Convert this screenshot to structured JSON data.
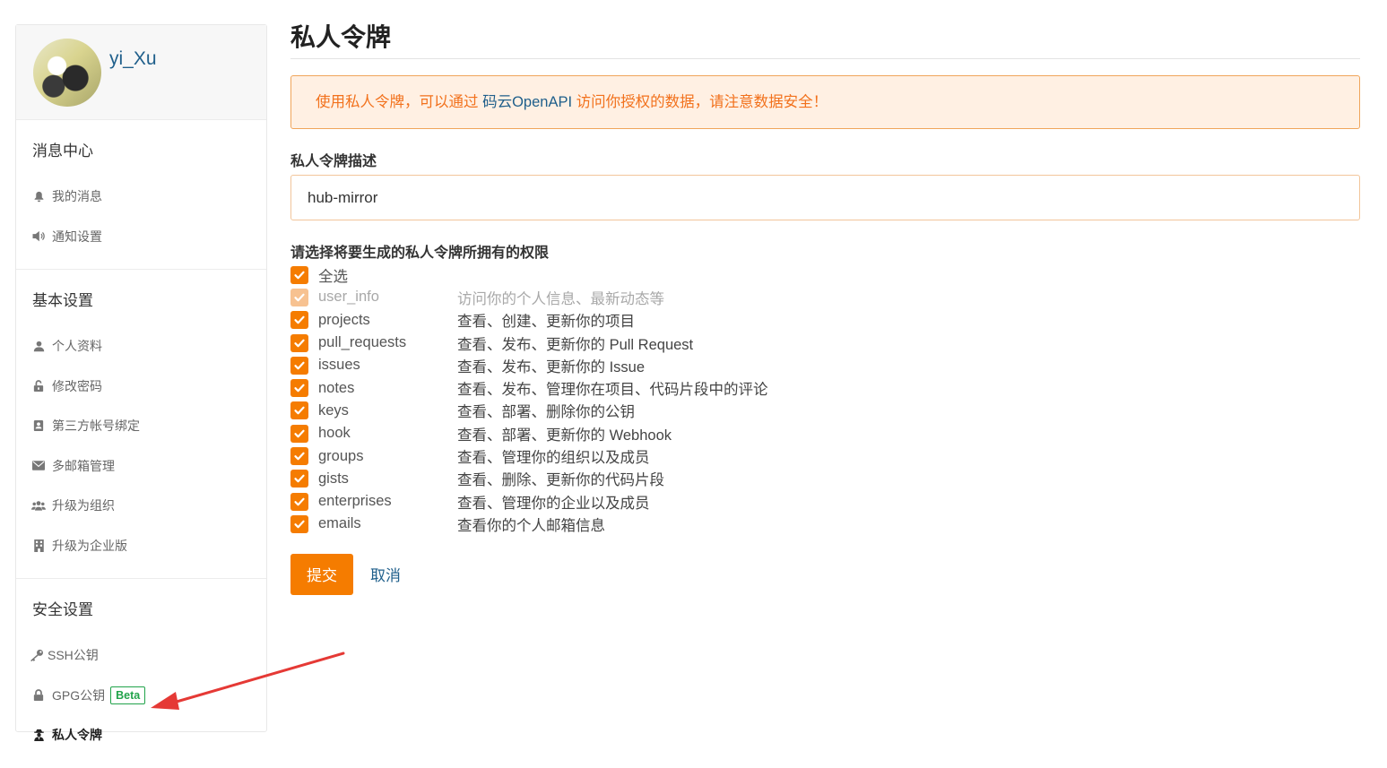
{
  "profile": {
    "username": "yi_Xu"
  },
  "sidebar": {
    "sections": [
      {
        "title": "消息中心",
        "items": [
          {
            "label": "我的消息",
            "icon": "bell-icon"
          },
          {
            "label": "通知设置",
            "icon": "volume-icon"
          }
        ]
      },
      {
        "title": "基本设置",
        "items": [
          {
            "label": "个人资料",
            "icon": "user-icon"
          },
          {
            "label": "修改密码",
            "icon": "unlock-icon"
          },
          {
            "label": "第三方帐号绑定",
            "icon": "address-card-icon"
          },
          {
            "label": "多邮箱管理",
            "icon": "envelope-icon"
          },
          {
            "label": "升级为组织",
            "icon": "users-icon"
          },
          {
            "label": "升级为企业版",
            "icon": "building-icon"
          }
        ]
      },
      {
        "title": "安全设置",
        "items": [
          {
            "label": "SSH公钥",
            "icon": "key-icon"
          },
          {
            "label": "GPG公钥",
            "icon": "lock-icon",
            "badge": "Beta"
          },
          {
            "label": "私人令牌",
            "icon": "user-secret-icon",
            "active": true
          }
        ]
      }
    ]
  },
  "main": {
    "title": "私人令牌",
    "notice": {
      "prefix": "使用私人令牌，可以通过 ",
      "link": "码云OpenAPI",
      "suffix": " 访问你授权的数据，请注意数据安全！"
    },
    "description_label": "私人令牌描述",
    "description_value": "hub-mirror",
    "permissions_label": "请选择将要生成的私人令牌所拥有的权限",
    "select_all": "全选",
    "permissions": [
      {
        "name": "user_info",
        "desc": "访问你的个人信息、最新动态等",
        "disabled": true
      },
      {
        "name": "projects",
        "desc": "查看、创建、更新你的项目"
      },
      {
        "name": "pull_requests",
        "desc": "查看、发布、更新你的 Pull Request"
      },
      {
        "name": "issues",
        "desc": "查看、发布、更新你的 Issue"
      },
      {
        "name": "notes",
        "desc": "查看、发布、管理你在项目、代码片段中的评论"
      },
      {
        "name": "keys",
        "desc": "查看、部署、删除你的公钥"
      },
      {
        "name": "hook",
        "desc": "查看、部署、更新你的 Webhook"
      },
      {
        "name": "groups",
        "desc": "查看、管理你的组织以及成员"
      },
      {
        "name": "gists",
        "desc": "查看、删除、更新你的代码片段"
      },
      {
        "name": "enterprises",
        "desc": "查看、管理你的企业以及成员"
      },
      {
        "name": "emails",
        "desc": "查看你的个人邮箱信息"
      }
    ],
    "submit_label": "提交",
    "cancel_label": "取消"
  },
  "colors": {
    "accent": "#f57c00",
    "link": "#1f5f8b",
    "notice_bg": "#fff0e3",
    "annotation": "#e53935"
  }
}
